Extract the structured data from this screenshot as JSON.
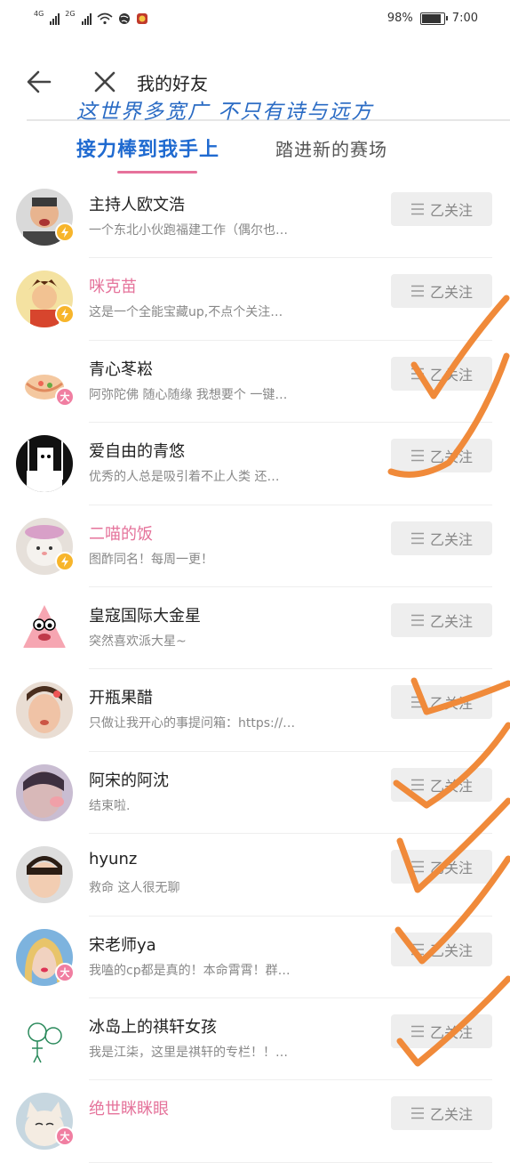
{
  "status_bar": {
    "net1": "4G",
    "net2": "2G",
    "battery": "98%",
    "battery_level": 0.98,
    "time": "7:00"
  },
  "header": {
    "title": "我的好友",
    "overlay_line1": "这世界多宽广 不只有诗与远方",
    "overlay_line2": "接力棒到我手上",
    "overlay_line3": "踏进新的赛场"
  },
  "colors": {
    "accent_pink": "#e5739b",
    "check_orange": "#f08a3a",
    "overlay_blue": "#1f6ad0"
  },
  "icons": {
    "back": "arrow-left-icon",
    "close": "close-icon",
    "follow": "follow-menu-icon",
    "badge_star": "lightning-badge-icon",
    "badge_big": "big-member-badge"
  },
  "follow_label": "乙关注",
  "friends": [
    {
      "name": "主持人欧文浩",
      "desc": "一个东北小伙跑福建工作（偶尔也…",
      "name_style": "normal",
      "badge": "star"
    },
    {
      "name": "咪克苗",
      "desc": "这是一个全能宝藏up,不点个关注…",
      "name_style": "pink",
      "badge": "star"
    },
    {
      "name": "青心苳崧",
      "desc": "阿弥陀佛 随心随缘 我想要个 一键…",
      "name_style": "normal",
      "badge": "big"
    },
    {
      "name": "爱自由的青悠",
      "desc": "优秀的人总是吸引着不止人类 还…",
      "name_style": "normal",
      "badge": ""
    },
    {
      "name": "二喵的饭",
      "desc": "图酢同名！每周一更！",
      "name_style": "pink",
      "badge": "star"
    },
    {
      "name": "皇寇国际大金星",
      "desc": "突然喜欢派大星~",
      "name_style": "normal",
      "badge": ""
    },
    {
      "name": "开瓶果醋",
      "desc": "只做让我开心的事提问箱：https://…",
      "name_style": "normal",
      "badge": ""
    },
    {
      "name": "阿宋的阿沈",
      "desc": "结束啦.",
      "name_style": "normal",
      "badge": ""
    },
    {
      "name": "hyunz",
      "desc": "救命 这人很无聊",
      "name_style": "normal",
      "badge": ""
    },
    {
      "name": "宋老师ya",
      "desc": "我嗑的cp都是真的！本命霄霄！群…",
      "name_style": "normal",
      "badge": "big"
    },
    {
      "name": "冰岛上的祺轩女孩",
      "desc": "我是江柒，这里是祺轩的专栏！！…",
      "name_style": "normal",
      "badge": ""
    },
    {
      "name": "绝世眯眯眼",
      "desc": "",
      "name_style": "pink",
      "badge": "big"
    }
  ],
  "badge_text": {
    "big": "大"
  }
}
